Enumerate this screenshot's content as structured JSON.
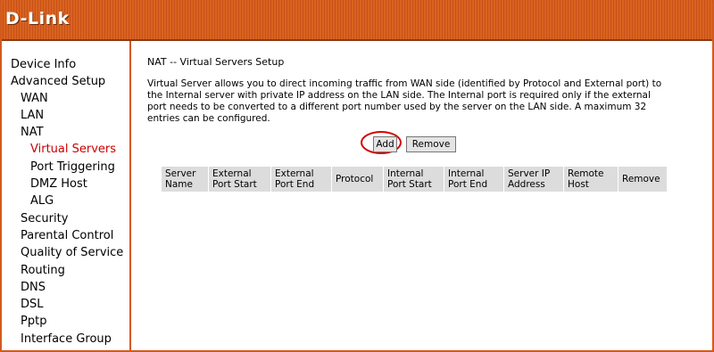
{
  "brand": {
    "logo": "D-Link"
  },
  "sidebar": {
    "items": [
      {
        "label": "Device Info"
      },
      {
        "label": "Advanced Setup"
      },
      {
        "label": "WAN"
      },
      {
        "label": "LAN"
      },
      {
        "label": "NAT"
      },
      {
        "label": "Virtual Servers"
      },
      {
        "label": "Port Triggering"
      },
      {
        "label": "DMZ Host"
      },
      {
        "label": "ALG"
      },
      {
        "label": "Security"
      },
      {
        "label": "Parental Control"
      },
      {
        "label": "Quality of Service"
      },
      {
        "label": "Routing"
      },
      {
        "label": "DNS"
      },
      {
        "label": "DSL"
      },
      {
        "label": "Pptp"
      },
      {
        "label": "Interface Group"
      }
    ]
  },
  "main": {
    "title": "NAT -- Virtual Servers Setup",
    "description": "Virtual Server allows you to direct incoming traffic from WAN side (identified by Protocol and External port) to the Internal server with private IP address on the LAN side. The Internal port is required only if the external port needs to be converted to a different port number used by the server on the LAN side. A maximum 32 entries can be configured.",
    "buttons": {
      "add": "Add",
      "remove": "Remove"
    },
    "table": {
      "headers": [
        "Server Name",
        "External Port Start",
        "External Port End",
        "Protocol",
        "Internal Port Start",
        "Internal Port End",
        "Server IP Address",
        "Remote Host",
        "Remove"
      ]
    }
  },
  "colors": {
    "accent": "#d35a1f",
    "active_link": "#cc0000",
    "highlight_circle": "#d40000"
  }
}
